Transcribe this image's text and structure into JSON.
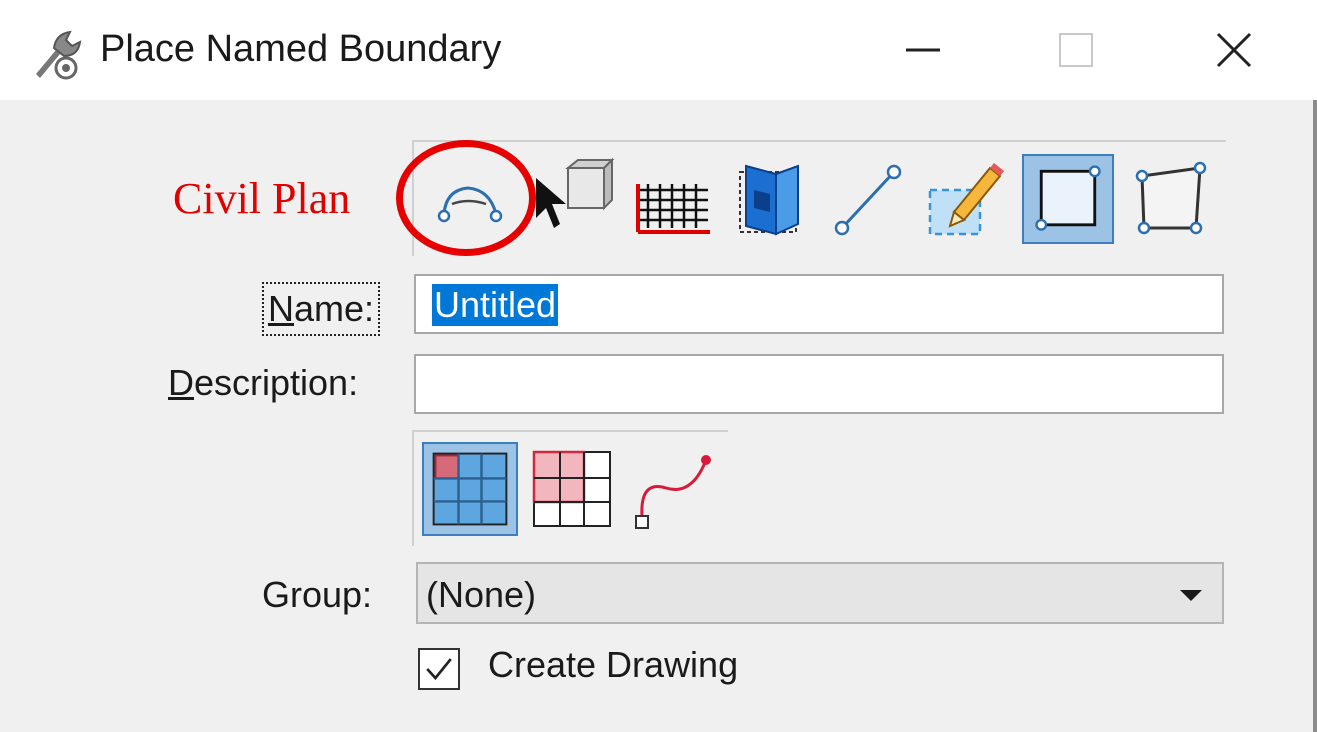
{
  "window": {
    "title": "Place Named Boundary",
    "controls": [
      "minimize",
      "maximize",
      "close"
    ]
  },
  "annotation": {
    "label": "Civil Plan",
    "color": "#e60000"
  },
  "toolbar": {
    "tools": [
      {
        "icon": "civil-plan-arc-icon",
        "active": false
      },
      {
        "icon": "select-element-icon",
        "active": false
      },
      {
        "icon": "grid-icon",
        "active": false
      },
      {
        "icon": "3d-box-icon",
        "active": false
      },
      {
        "icon": "line-icon",
        "active": false
      },
      {
        "icon": "sheet-pencil-icon",
        "active": false
      },
      {
        "icon": "square-boundary-icon",
        "active": true
      },
      {
        "icon": "shape-boundary-icon",
        "active": false
      }
    ]
  },
  "form": {
    "name_label_initial": "N",
    "name_label_rest": "ame:",
    "name_value": "Untitled",
    "description_label_initial": "D",
    "description_label_rest": "escription:",
    "description_value": "",
    "group_label": "Group:",
    "group_value": "(None)",
    "create_drawing_label": "Create Drawing",
    "create_drawing_checked": true
  },
  "mode_tools": [
    {
      "icon": "grid-select-one-icon",
      "active": true
    },
    {
      "icon": "grid-select-multiple-icon",
      "active": false
    },
    {
      "icon": "curve-path-icon",
      "active": false
    }
  ],
  "colors": {
    "accent_blue": "#3c7fc0",
    "active_fill": "#9cc3e6",
    "selection": "#0078d7",
    "panel": "#f0f0f0"
  }
}
